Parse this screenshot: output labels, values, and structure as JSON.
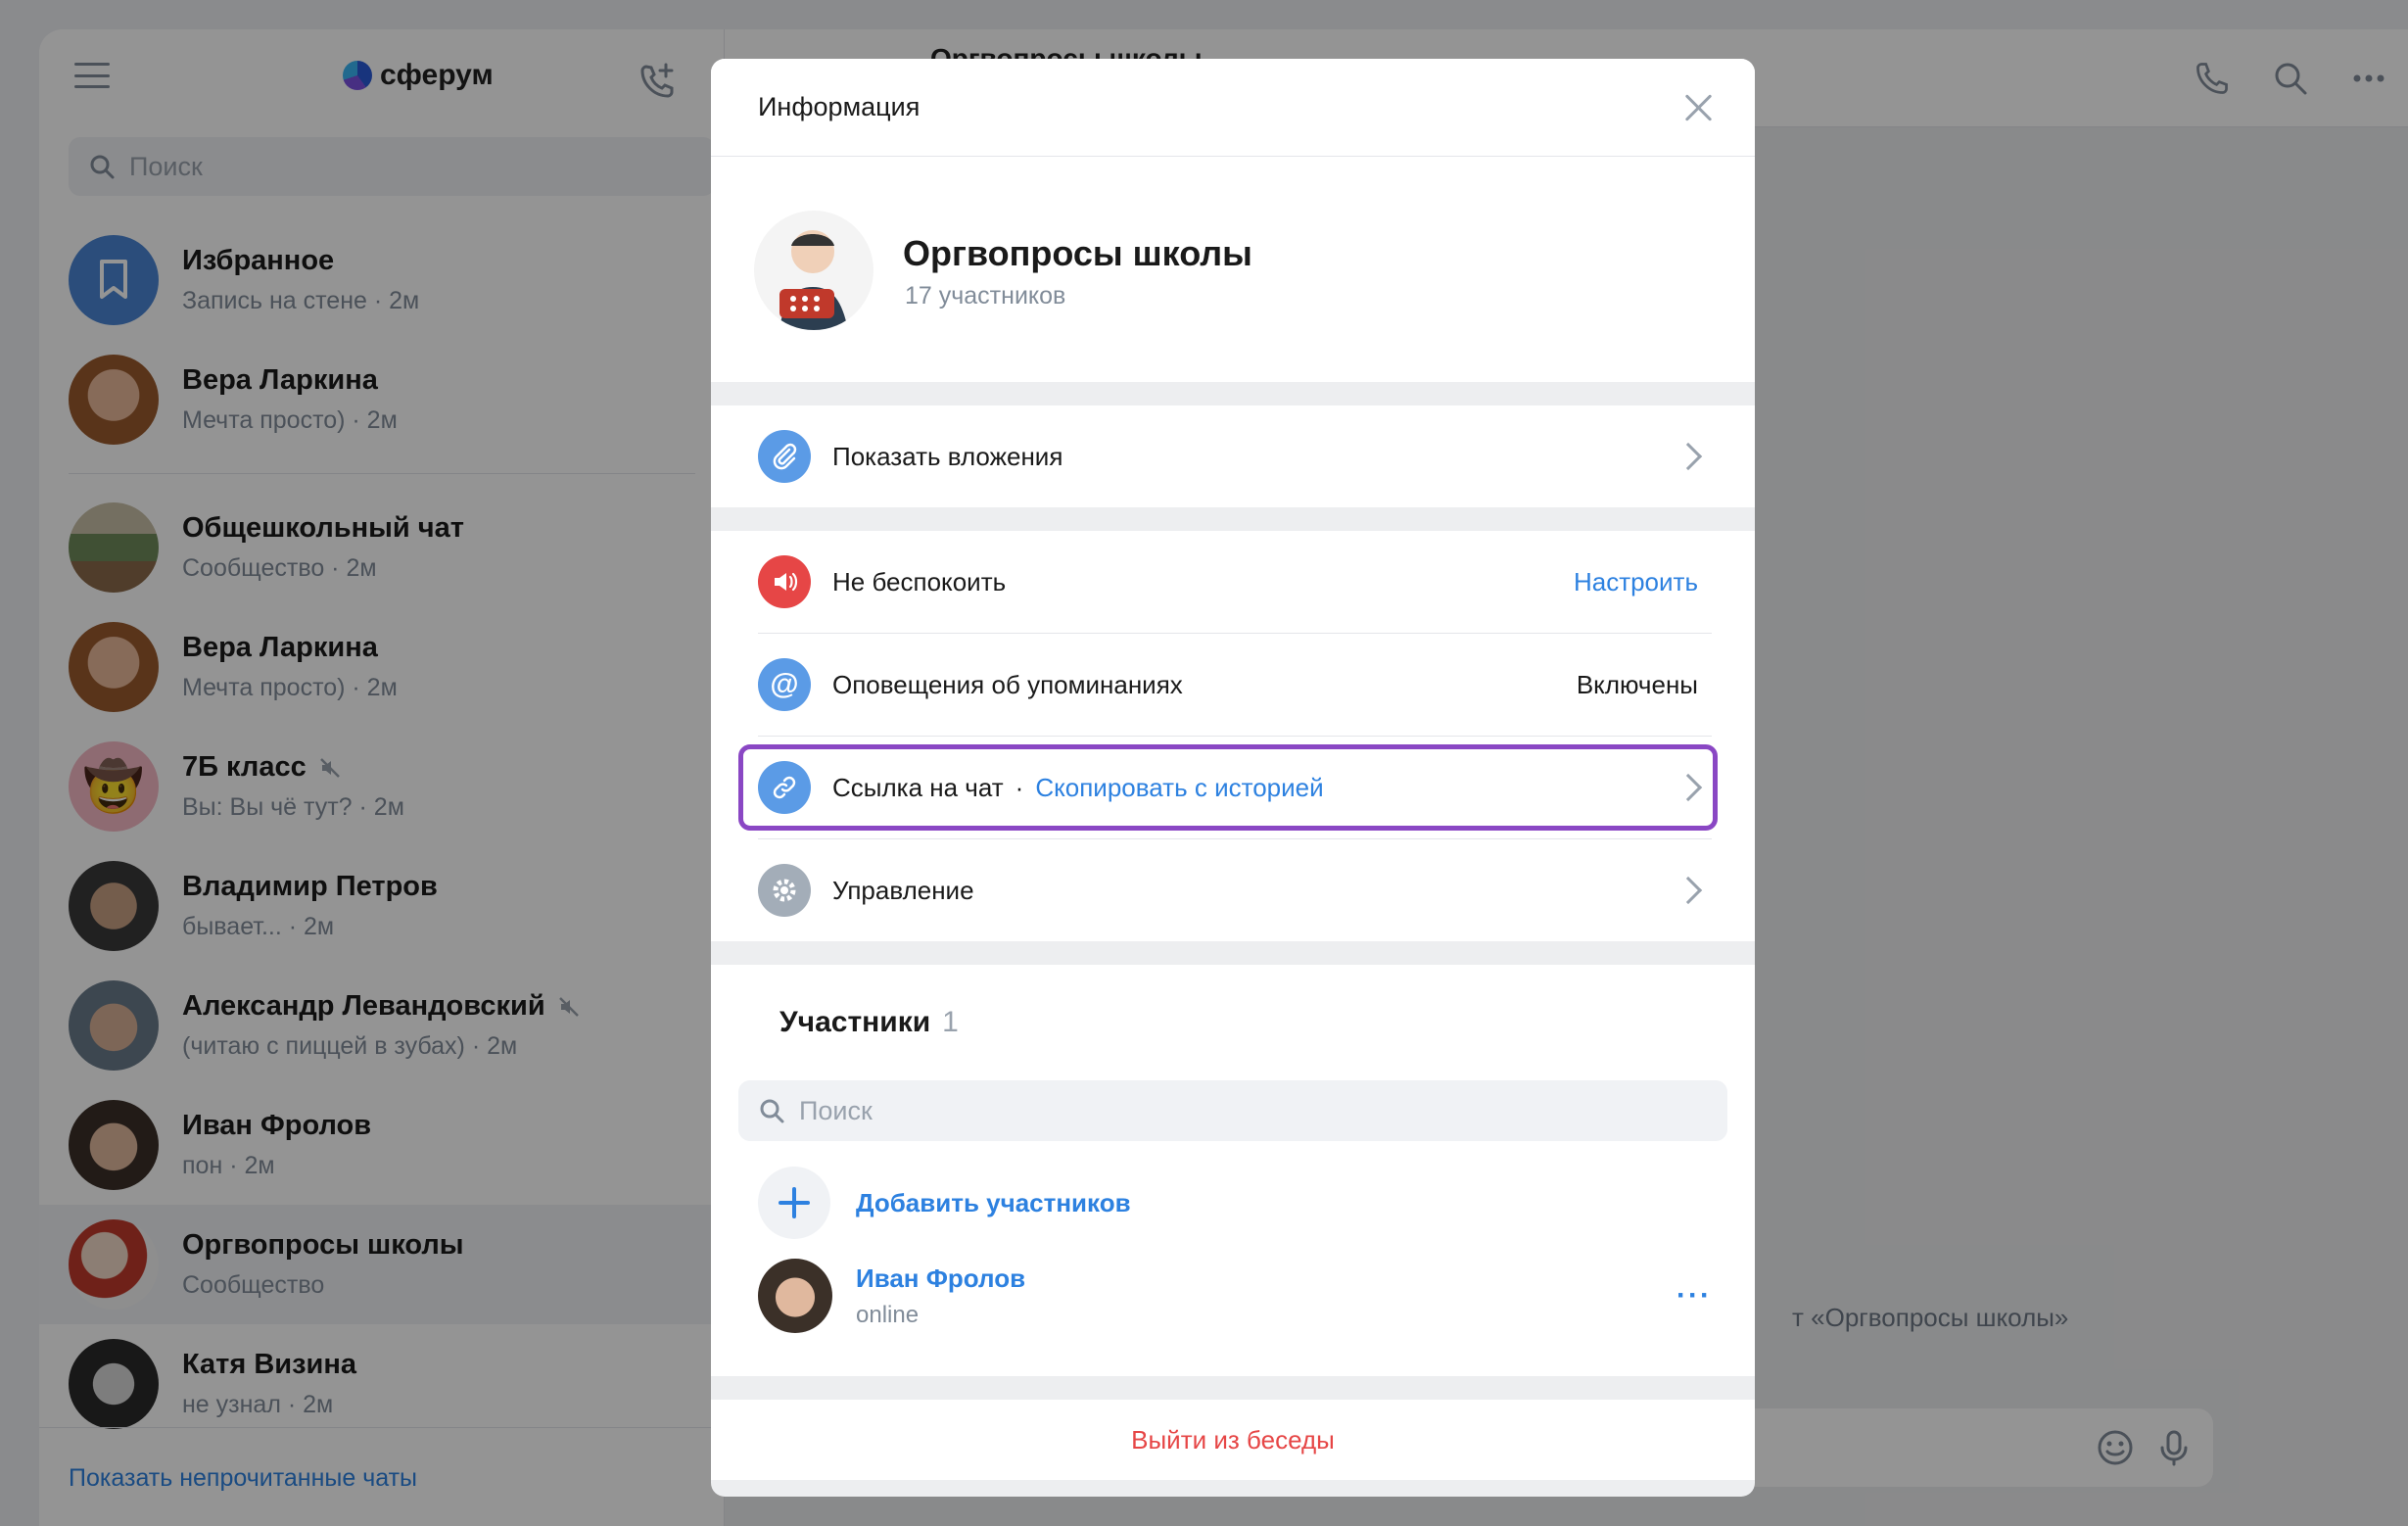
{
  "app": {
    "name": "сферум"
  },
  "sidebar": {
    "search_placeholder": "Поиск",
    "chats": [
      {
        "name": "Избранное",
        "sub": "Запись на стене · 2м"
      },
      {
        "name": "Вера Ларкина",
        "sub": "Мечта просто) · 2м"
      },
      {
        "name": "Общешкольный чат",
        "sub": "Сообщество · 2м"
      },
      {
        "name": "Вера Ларкина",
        "sub": "Мечта просто) · 2м"
      },
      {
        "name": "7Б класс",
        "sub": "Вы: Вы чё тут? · 2м"
      },
      {
        "name": "Владимир Петров",
        "sub": "бывает... · 2м"
      },
      {
        "name": "Александр Левандовский",
        "sub": "(читаю с пиццей в зубах) · 2м"
      },
      {
        "name": "Иван Фролов",
        "sub": "пон · 2м"
      },
      {
        "name": "Оргвопросы школы",
        "sub": "Сообщество"
      },
      {
        "name": "Катя Визина",
        "sub": "не узнал · 2м"
      }
    ],
    "show_unread": "Показать непрочитанные чаты"
  },
  "chat_area": {
    "title": "Оргвопросы школы",
    "system_message": "т «Оргвопросы школы»"
  },
  "modal": {
    "title": "Информация",
    "profile": {
      "name": "Оргвопросы школы",
      "members_count": "17 участников"
    },
    "rows": {
      "attachments": "Показать вложения",
      "dnd_label": "Не беспокоить",
      "dnd_action": "Настроить",
      "mentions_label": "Оповещения об упоминаниях",
      "mentions_value": "Включены",
      "link_label": "Ссылка на чат",
      "link_separator": "·",
      "link_action": "Скопировать с историей",
      "manage": "Управление"
    },
    "members": {
      "title": "Участники",
      "count": "1",
      "search_placeholder": "Поиск",
      "add_label": "Добавить участников",
      "list": [
        {
          "name": "Иван Фролов",
          "status": "online"
        }
      ]
    },
    "leave": "Выйти из беседы"
  },
  "colors": {
    "accent": "#2d81e0",
    "highlight": "#8a47c4",
    "danger": "#e64646"
  }
}
